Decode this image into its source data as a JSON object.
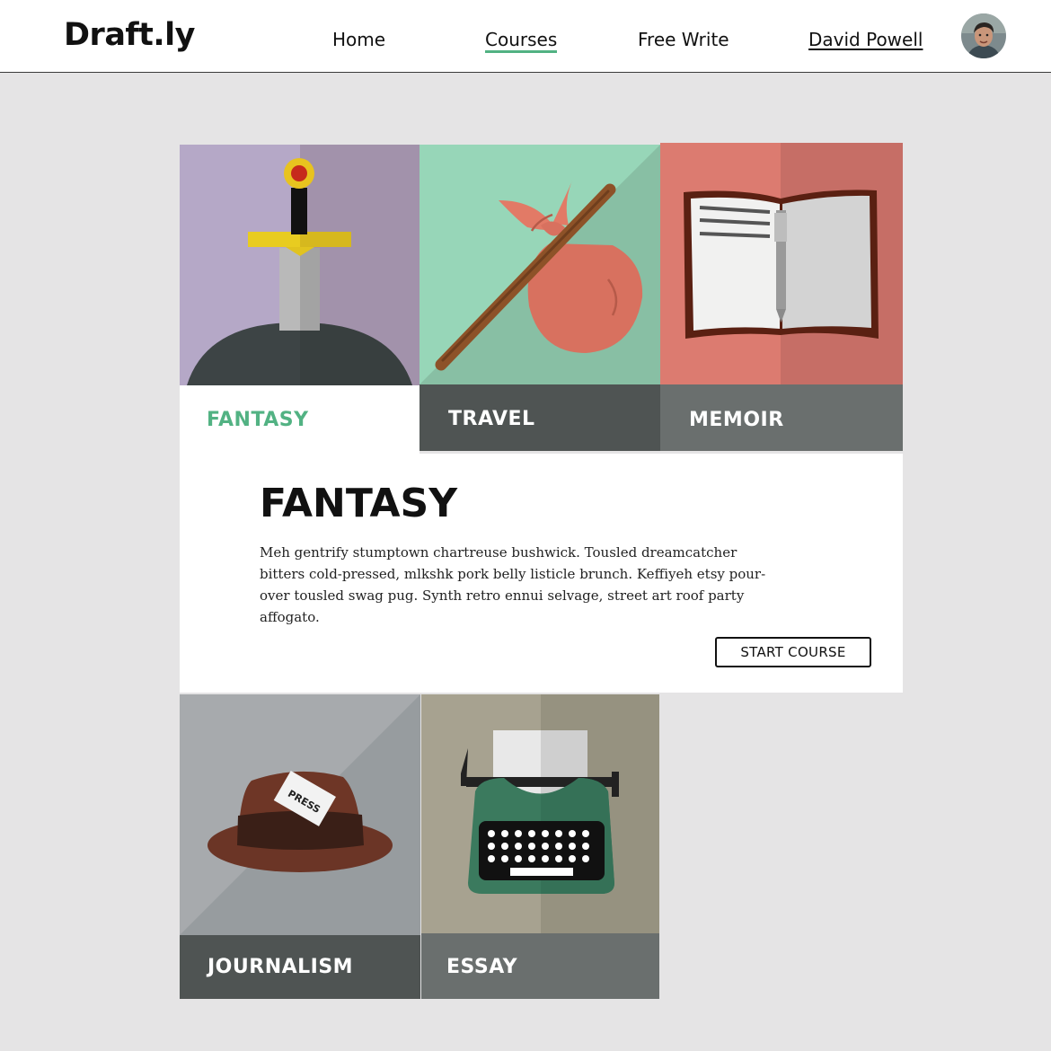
{
  "brand": {
    "name": "Draft.ly"
  },
  "nav": {
    "home": "Home",
    "courses": "Courses",
    "free_write": "Free Write",
    "user_name": "David Powell"
  },
  "active_nav": "Courses",
  "accent_color": "#52b283",
  "tabs": [
    {
      "label": "FANTASY",
      "icon": "sword-in-stone-icon",
      "color": "#b5a8c7",
      "selected": true
    },
    {
      "label": "TRAVEL",
      "icon": "bindle-icon",
      "color": "#97d6b8",
      "selected": false
    },
    {
      "label": "MEMOIR",
      "icon": "notebook-pen-icon",
      "color": "#dc7b70",
      "selected": false
    }
  ],
  "detail": {
    "title": "FANTASY",
    "body": "Meh gentrify stumptown chartreuse bushwick. Tousled dreamcatcher bitters cold-pressed, mlkshk pork belly listicle brunch. Keffiyeh etsy pour-over tousled swag pug. Synth retro ennui selvage, street art roof party affogato.",
    "button": "START COURSE"
  },
  "more_courses": [
    {
      "label": "JOURNALISM",
      "icon": "press-hat-icon",
      "color": "#a7aaad"
    },
    {
      "label": "ESSAY",
      "icon": "typewriter-icon",
      "color": "#a7a290"
    }
  ],
  "hat_badge_text": "PRESS"
}
